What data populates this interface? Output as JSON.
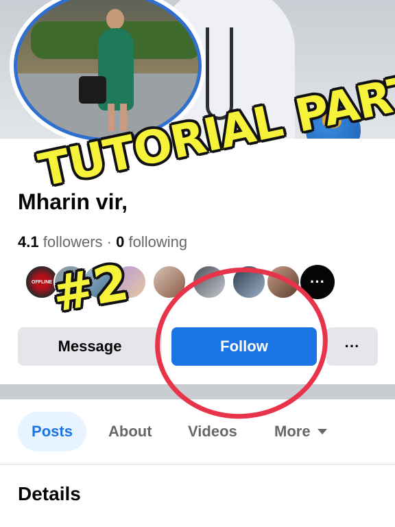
{
  "profile": {
    "name": "Mharin          vir,",
    "stats": {
      "followers_count": "4.1",
      "followers_label": "followers",
      "separator": "·",
      "following_count": "0",
      "following_label": "following"
    },
    "friends_more_label": "···",
    "friend_badge": "OFFLINE"
  },
  "actions": {
    "message_label": "Message",
    "follow_label": "Follow",
    "more_label": "···"
  },
  "tabs": [
    {
      "label": "Posts"
    },
    {
      "label": "About"
    },
    {
      "label": "Videos"
    },
    {
      "label": "More"
    }
  ],
  "section_title": "Details",
  "overlay": {
    "title": "TUTORIAL PART",
    "number": "#2"
  },
  "colors": {
    "follow_blue": "#1b74e4",
    "highlight_red": "#e8344a",
    "overlay_yellow": "#f6f23a"
  }
}
